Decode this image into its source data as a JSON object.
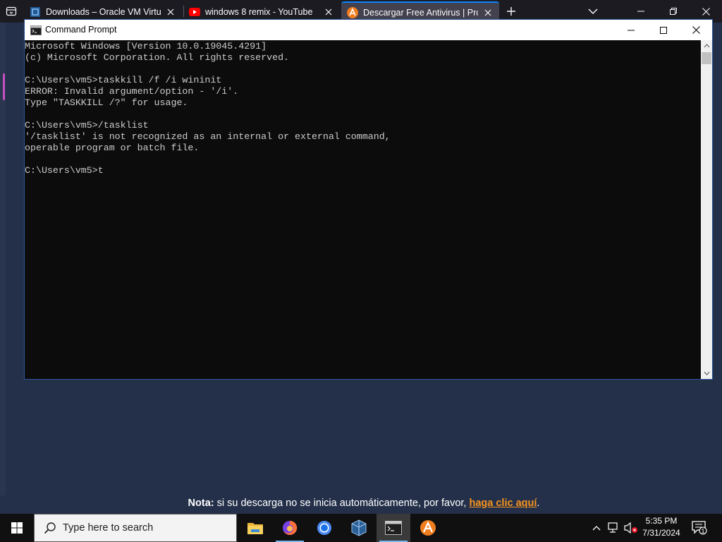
{
  "browser": {
    "tabs": [
      {
        "title": "Downloads – Oracle VM VirtualBox",
        "favicon": "virtualbox-icon"
      },
      {
        "title": "windows 8 remix - YouTube",
        "favicon": "youtube-icon"
      },
      {
        "title": "Descargar Free Antivirus | Protección",
        "favicon": "avast-icon"
      }
    ]
  },
  "cmd": {
    "title": "Command Prompt",
    "lines": [
      "Microsoft Windows [Version 10.0.19045.4291]",
      "(c) Microsoft Corporation. All rights reserved.",
      "",
      "C:\\Users\\vm5>taskkill /f /i wininit",
      "ERROR: Invalid argument/option - '/i'.",
      "Type \"TASKKILL /?\" for usage.",
      "",
      "C:\\Users\\vm5>/tasklist",
      "'/tasklist' is not recognized as an internal or external command,",
      "operable program or batch file.",
      "",
      "C:\\Users\\vm5>t"
    ]
  },
  "note": {
    "label": "Nota:",
    "text": " si su descarga no se inicia automáticamente, por favor, ",
    "link": "haga clic aquí",
    "end": "."
  },
  "taskbar": {
    "search_placeholder": "Type here to search",
    "time": "5:35 PM",
    "date": "7/31/2024",
    "notification_count": "1"
  },
  "colors": {
    "console_bg": "#0c0c0c",
    "console_text": "#cccccc",
    "note_link": "#f7941d",
    "active_tab_accent": "#0a84ff"
  }
}
